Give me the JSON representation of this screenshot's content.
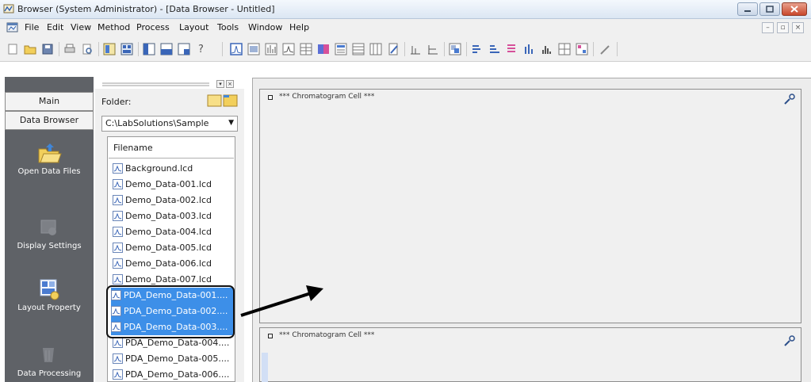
{
  "window": {
    "title": "Browser (System Administrator) - [Data Browser - Untitled]"
  },
  "menu": {
    "items": [
      "File",
      "Edit",
      "View",
      "Method",
      "Process",
      "Layout",
      "Tools",
      "Window",
      "Help"
    ]
  },
  "toolbar": {
    "help_label": "?"
  },
  "nav": {
    "tabs": [
      "Main",
      "Data Browser"
    ],
    "items": [
      {
        "label": "Open Data Files",
        "icon": "open-folder-icon"
      },
      {
        "label": "Display Settings",
        "icon": "display-settings-icon"
      },
      {
        "label": "Layout Property",
        "icon": "layout-property-icon"
      },
      {
        "label": "Data Processing",
        "icon": "data-processing-icon"
      }
    ]
  },
  "file_browser": {
    "folder_label": "Folder:",
    "folder_value": "C:\\LabSolutions\\Sample",
    "column_header": "Filename",
    "files": [
      {
        "name": "Background.lcd",
        "selected": false
      },
      {
        "name": "Demo_Data-001.lcd",
        "selected": false
      },
      {
        "name": "Demo_Data-002.lcd",
        "selected": false
      },
      {
        "name": "Demo_Data-003.lcd",
        "selected": false
      },
      {
        "name": "Demo_Data-004.lcd",
        "selected": false
      },
      {
        "name": "Demo_Data-005.lcd",
        "selected": false
      },
      {
        "name": "Demo_Data-006.lcd",
        "selected": false
      },
      {
        "name": "Demo_Data-007.lcd",
        "selected": false
      },
      {
        "name": "PDA_Demo_Data-001....",
        "selected": true
      },
      {
        "name": "PDA_Demo_Data-002....",
        "selected": true
      },
      {
        "name": "PDA_Demo_Data-003....",
        "selected": true
      },
      {
        "name": "PDA_Demo_Data-004....",
        "selected": false
      },
      {
        "name": "PDA_Demo_Data-005....",
        "selected": false
      },
      {
        "name": "PDA_Demo_Data-006....",
        "selected": false
      }
    ]
  },
  "cells": [
    {
      "title": "*** Chromatogram Cell ***"
    },
    {
      "title": "*** Chromatogram Cell ***"
    }
  ],
  "colors": {
    "selection": "#3d8fe8",
    "nav_background": "#5f6267",
    "annotation": "#000000"
  }
}
